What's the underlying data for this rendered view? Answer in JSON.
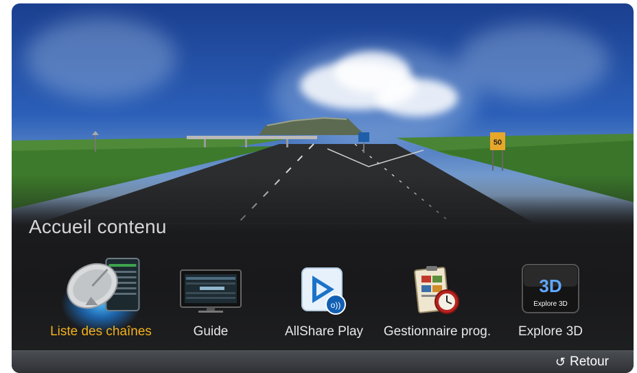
{
  "page_title": "Accueil contenu",
  "apps": [
    {
      "label": "Liste des chaînes",
      "icon": "satellite-dish-icon",
      "selected": true
    },
    {
      "label": "Guide",
      "icon": "tv-guide-icon"
    },
    {
      "label": "AllShare Play",
      "icon": "allshare-play-icon"
    },
    {
      "label": "Gestionnaire prog.",
      "icon": "schedule-manager-icon"
    },
    {
      "label": "Explore 3D",
      "icon": "explore-3d-icon",
      "icon_text": "Explore 3D"
    }
  ],
  "bottom_bar": {
    "return_label": "Retour",
    "return_icon": "return-arrow-icon"
  },
  "sign_text": "50",
  "colors": {
    "selected_label": "#f2b21b",
    "label": "#e8e8e8",
    "sky": "#2b5fb8"
  }
}
